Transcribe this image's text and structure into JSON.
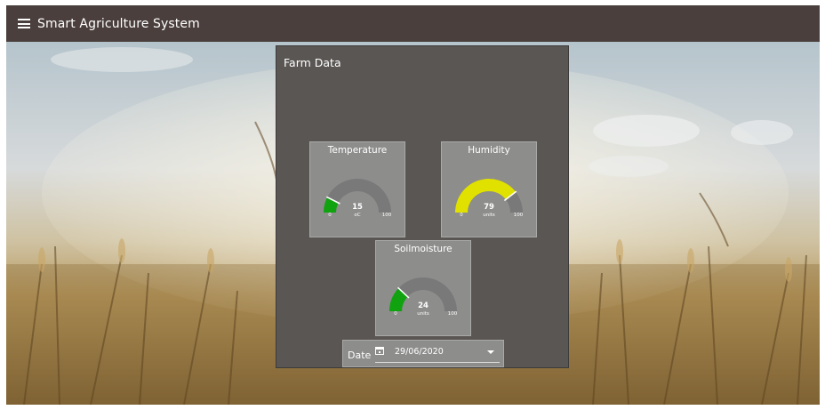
{
  "app": {
    "title": "Smart Agriculture System",
    "menu_icon": "hamburger-icon"
  },
  "panel": {
    "title": "Farm Data"
  },
  "gauges": [
    {
      "key": "temperature",
      "title": "Temperature",
      "value": 15,
      "unit": "oC",
      "min": 0,
      "max": 100,
      "color": "#10a30f"
    },
    {
      "key": "humidity",
      "title": "Humidity",
      "value": 79,
      "unit": "units",
      "min": 0,
      "max": 100,
      "color": "#e1e100"
    },
    {
      "key": "soilmoisture",
      "title": "Soilmoisture",
      "value": 24,
      "unit": "units",
      "min": 0,
      "max": 100,
      "color": "#10a30f"
    }
  ],
  "date": {
    "label": "Date",
    "value": "29/06/2020",
    "icon": "calendar-icon"
  },
  "colors": {
    "topbar": "#4a3f3c",
    "panel": "#5a5654",
    "card": "#8d8d8c",
    "track": "#7a7979"
  }
}
